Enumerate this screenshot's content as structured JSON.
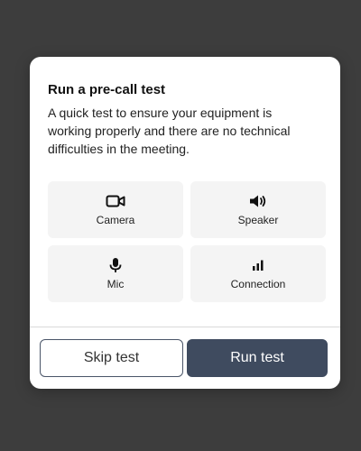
{
  "modal": {
    "title": "Run a pre-call test",
    "description": "A quick test to ensure your equipment is working properly and there are no technical difficulties in the meeting."
  },
  "tests": [
    {
      "label": "Camera",
      "icon": "camera-icon"
    },
    {
      "label": "Speaker",
      "icon": "speaker-icon"
    },
    {
      "label": "Mic",
      "icon": "mic-icon"
    },
    {
      "label": "Connection",
      "icon": "signal-bars-icon"
    }
  ],
  "buttons": {
    "skip_label": "Skip test",
    "run_label": "Run test"
  },
  "colors": {
    "backdrop": "#3d3d3d",
    "primary_button": "#3f4b5f",
    "tile_background": "#f4f4f4"
  }
}
